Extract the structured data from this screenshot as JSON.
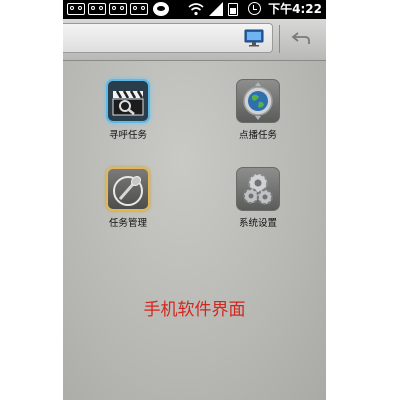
{
  "status_bar": {
    "time": "下午4:22",
    "icons": [
      "voicemail-icon",
      "voicemail-icon",
      "voicemail-icon",
      "voicemail-icon",
      "chat-icon",
      "wifi-icon",
      "signal-icon",
      "battery-icon",
      "alarm-icon"
    ]
  },
  "top_bar": {
    "icons": [
      "monitor-icon",
      "back-icon"
    ]
  },
  "apps": [
    {
      "label": "寻呼任务",
      "icon": "clapperboard-search-icon"
    },
    {
      "label": "点播任务",
      "icon": "globe-icon"
    },
    {
      "label": "任务管理",
      "icon": "microphone-icon"
    },
    {
      "label": "系统设置",
      "icon": "gears-icon"
    }
  ],
  "caption": "手机软件界面",
  "colors": {
    "caption": "#d4261e",
    "status_bar": "#000000",
    "find_icon_glow": "#5fb8e6",
    "manage_icon_glow": "#e0b85a"
  }
}
